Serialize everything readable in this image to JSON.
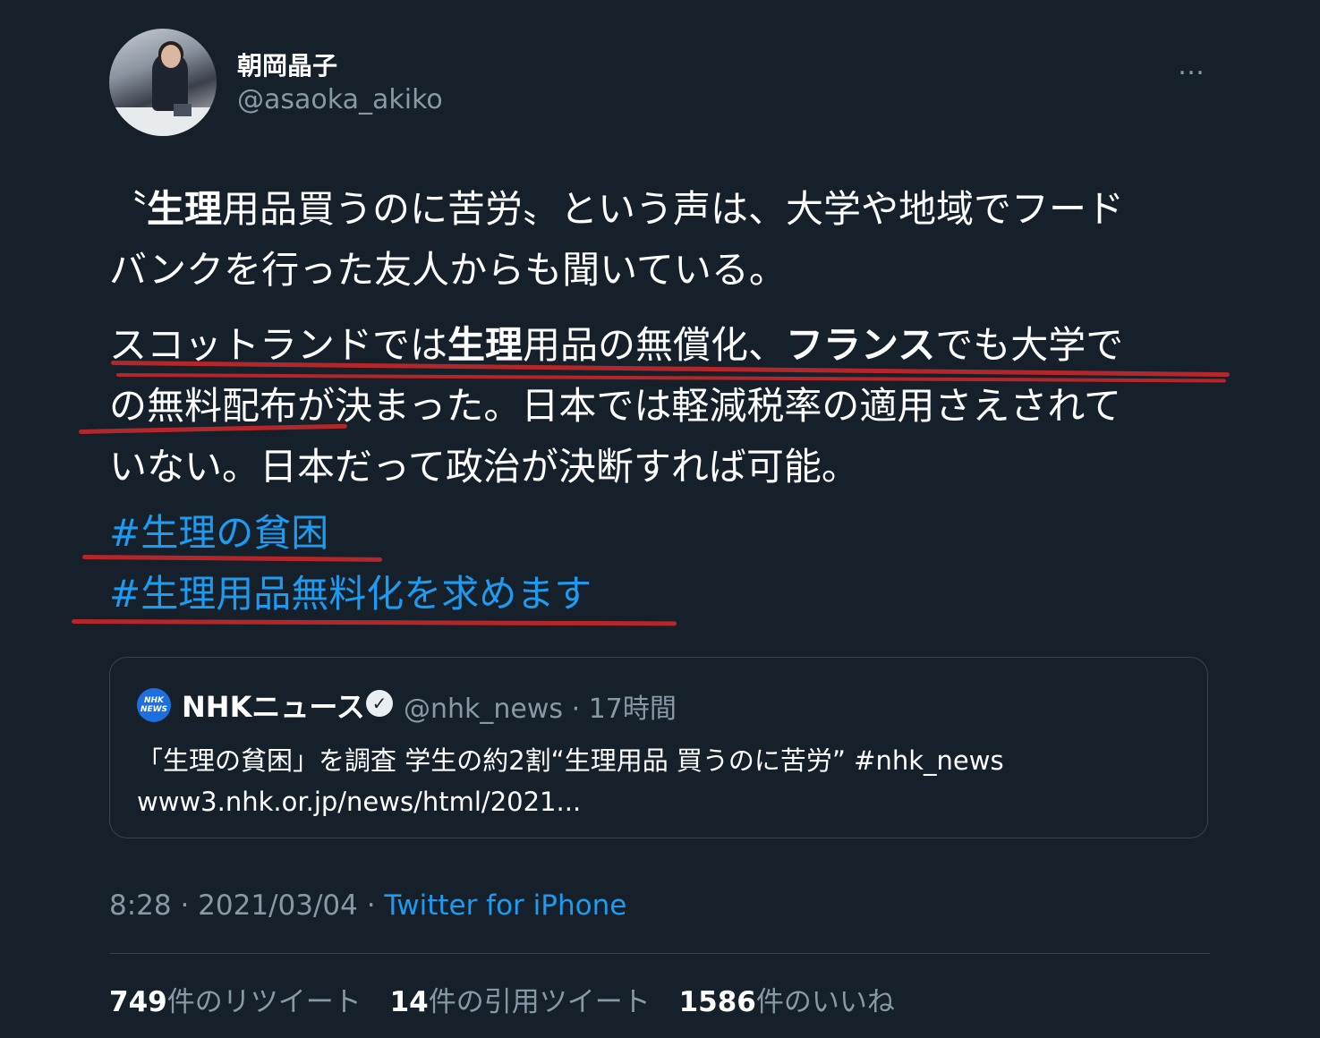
{
  "user": {
    "display_name": "朝岡晶子",
    "handle": "@asaoka_akiko",
    "more_icon": "…"
  },
  "tweet": {
    "p1_a": "〝",
    "p1_b": "生理",
    "p1_c": "用品買うのに苦労〟という声は、大学や地域でフード",
    "p1_d": "バンクを行った友人からも聞いている。",
    "p2_a": "スコットランドでは",
    "p2_b": "生理",
    "p2_c": "用品の無償化、",
    "p2_d": "フランス",
    "p2_e": "でも大学で",
    "p2_f": "の無料配布が決まった。日本では軽減税率の適用さえされて",
    "p2_g": "いない。日本だって政治が決断すれば可能。",
    "hashtags": [
      "#生理の貧困",
      "#生理用品無料化を求めます"
    ]
  },
  "quote": {
    "logo_text": "NHK NEWS",
    "name": "NHKニュース",
    "verified_icon": "✓",
    "handle": "@nhk_news",
    "separator": "·",
    "time": "17時間",
    "line1": "「生理の貧困」を調査 学生の約2割“生理用品 買うのに苦労” #nhk_news",
    "line2": "www3.nhk.or.jp/news/html/2021..."
  },
  "meta": {
    "time": "8:28 · 2021/03/04 · ",
    "source": "Twitter for iPhone"
  },
  "stats": {
    "retweets_count": "749",
    "retweets_label": "件のリツイート",
    "quotes_count": "14",
    "quotes_label": "件の引用ツイート",
    "likes_count": "1586",
    "likes_label": "件のいいね"
  },
  "colors": {
    "background": "#15202b",
    "link": "#1d9bf0",
    "muted": "#8899a6",
    "annotation": "#c4282a"
  }
}
